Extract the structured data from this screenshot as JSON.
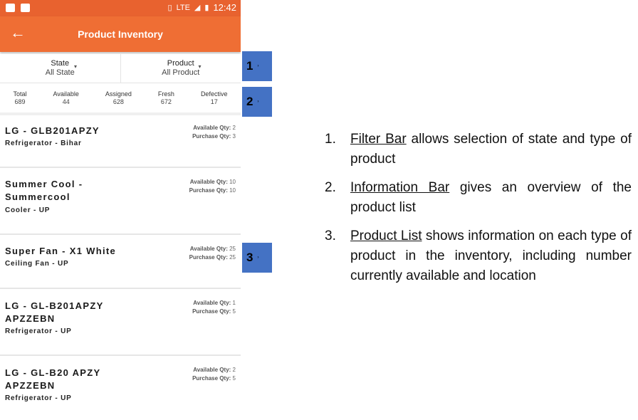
{
  "status_bar": {
    "time": "12:42",
    "network": "LTE"
  },
  "app_bar": {
    "title": "Product Inventory"
  },
  "filters": [
    {
      "label": "State",
      "value": "All State"
    },
    {
      "label": "Product",
      "value": "All Product"
    }
  ],
  "stats": [
    {
      "label": "Total",
      "value": "689"
    },
    {
      "label": "Available",
      "value": "44"
    },
    {
      "label": "Assigned",
      "value": "628"
    },
    {
      "label": "Fresh",
      "value": "672"
    },
    {
      "label": "Defective",
      "value": "17"
    }
  ],
  "qty_labels": {
    "available": "Available Qty:",
    "purchase": "Purchase Qty:"
  },
  "products": [
    {
      "name": "LG - GLB201APZY",
      "sub": "Refrigerator - Bihar",
      "available": "2",
      "purchase": "3"
    },
    {
      "name": "Summer Cool - Summercool",
      "sub": "Cooler - UP",
      "available": "10",
      "purchase": "10"
    },
    {
      "name": "Super Fan - X1 White",
      "sub": "Ceiling Fan - UP",
      "available": "25",
      "purchase": "25"
    },
    {
      "name": "LG - GL-B201APZY APZZEBN",
      "sub": "Refrigerator - UP",
      "available": "1",
      "purchase": "5"
    },
    {
      "name": "LG - GL-B20 APZY APZZEBN",
      "sub": "Refrigerator - UP",
      "available": "2",
      "purchase": "5"
    }
  ],
  "markers": [
    "1",
    "2",
    "3"
  ],
  "notes": [
    {
      "num": "1.",
      "term": "Filter Bar",
      "text": " allows selection of state and type of product"
    },
    {
      "num": "2.",
      "term": "Information Bar",
      "text": " gives an overview of the product list"
    },
    {
      "num": "3.",
      "term": "Product List",
      "text": " shows information on each type of product in the inventory, including number currently available and location"
    }
  ],
  "colors": {
    "status_bar": "#e8622f",
    "app_bar": "#ef6e34",
    "marker": "#4472c4"
  }
}
